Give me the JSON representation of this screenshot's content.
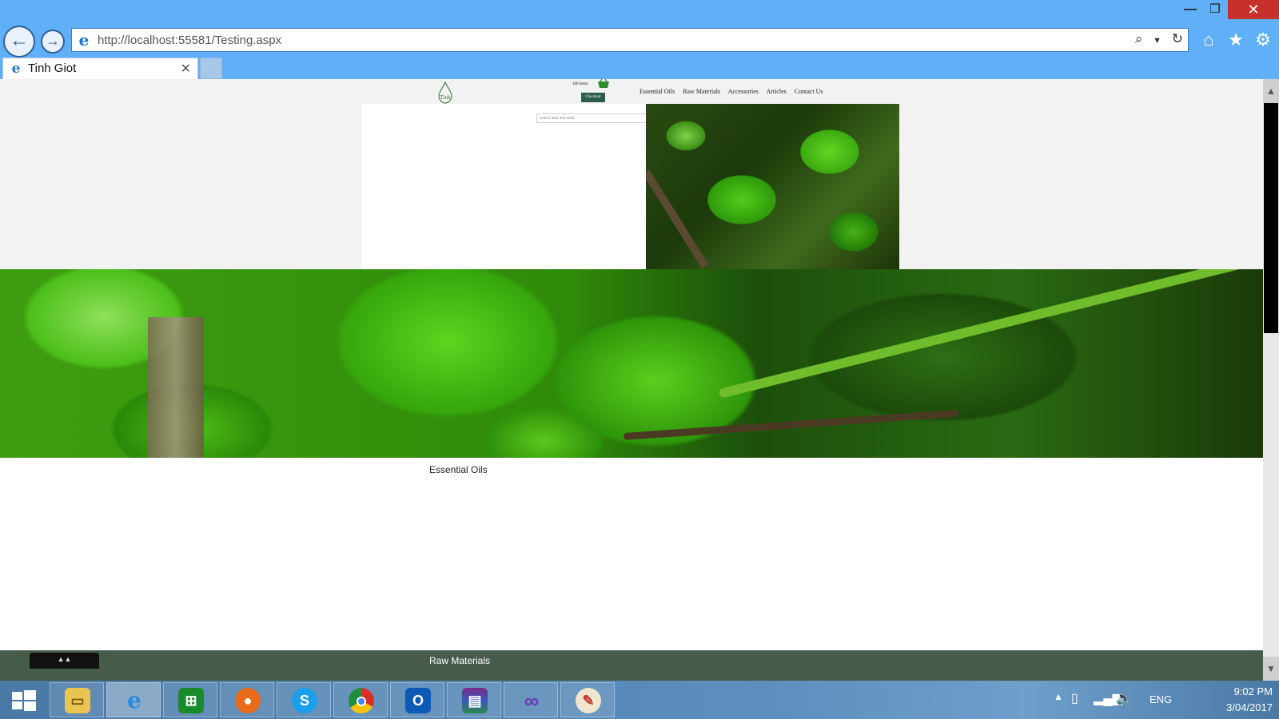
{
  "window": {
    "minimize_symbol": "—",
    "maximize_symbol": "❐",
    "close_symbol": "✕"
  },
  "browser": {
    "address": "http://localhost:55581/Testing.aspx",
    "back_symbol": "←",
    "forward_symbol": "→",
    "tab_title": "Tinh Giot",
    "tab_close_symbol": "✕",
    "icons": [
      "home-icon",
      "star-icon",
      "gear-icon",
      "search-icon",
      "refresh-icon"
    ]
  },
  "page": {
    "logo_text": "Tinh",
    "cart_count": "100 items",
    "checkout_label": "Checkout",
    "nav": [
      "Essential Oils",
      "Raw Materials",
      "Accessories",
      "Articles",
      "Contact Us"
    ],
    "search_placeholder": "Search Your Keyword",
    "sections": {
      "essential_oils": "Essential Oils",
      "raw_materials": "Raw Materials"
    },
    "colors": {
      "footer_band": "#465b4a",
      "checkout_button": "#2c5d4a",
      "leaf_green": "#4cbf1a"
    }
  },
  "taskbar": {
    "apps": [
      "File Explorer",
      "Internet Explorer",
      "Store",
      "Firefox",
      "Skype",
      "Chrome",
      "Outlook",
      "WinRAR",
      "Visual Studio",
      "Paint"
    ],
    "tray": {
      "language": "ENG",
      "time": "9:02 PM",
      "date": "3/04/2017"
    }
  }
}
